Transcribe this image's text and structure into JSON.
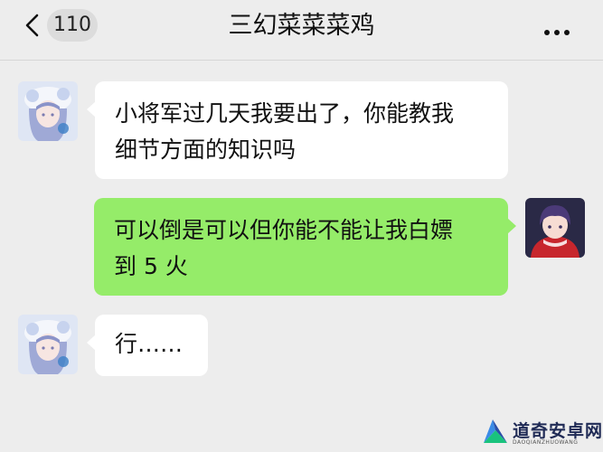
{
  "header": {
    "back_icon": "chevron-left-icon",
    "unread_count": "110",
    "title": "三幻菜菜菜鸡",
    "more_icon": "more-horizontal-icon"
  },
  "messages": [
    {
      "side": "incoming",
      "text": "小将军过几天我要出了，你能教我\n细节方面的知识吗"
    },
    {
      "side": "outgoing",
      "text": "可以倒是可以但你能不能让我白嫖\n到 5 火"
    },
    {
      "side": "incoming",
      "text": "行……"
    }
  ],
  "watermark": {
    "title": "道奇安卓网",
    "subtitle": "DAOQIANZHUOWANG"
  },
  "colors": {
    "background": "#ededed",
    "incoming_bubble": "#ffffff",
    "outgoing_bubble": "#95ec69",
    "watermark_text": "#1f2a55"
  }
}
